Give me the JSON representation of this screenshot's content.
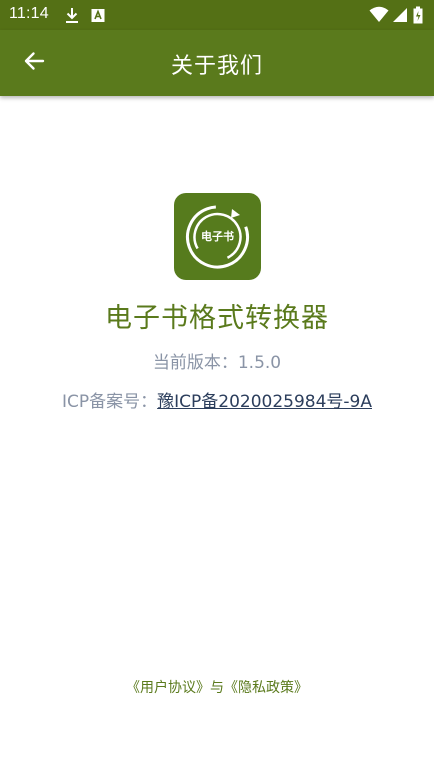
{
  "status_bar": {
    "time": "11:14",
    "icons": [
      "download-icon",
      "a-box-icon",
      "wifi-icon",
      "signal-icon",
      "battery-icon"
    ]
  },
  "app_bar": {
    "title": "关于我们",
    "back_icon": "arrow-left-icon",
    "background": "#5a7a1c"
  },
  "app": {
    "icon_label": "电子书",
    "name": "电子书格式转换器",
    "version_label": "当前版本：",
    "version": "1.5.0",
    "icp_label": "ICP备案号：",
    "icp_number": "豫ICP备2020025984号-9A"
  },
  "footer": {
    "user_agreement": "《用户协议》",
    "connector": "与",
    "privacy_policy": "《隐私政策》"
  },
  "colors": {
    "primary": "#5a7a1c",
    "status_bar": "#547015",
    "muted_text": "#8a94a6",
    "link_text": "#2c3e5c"
  }
}
